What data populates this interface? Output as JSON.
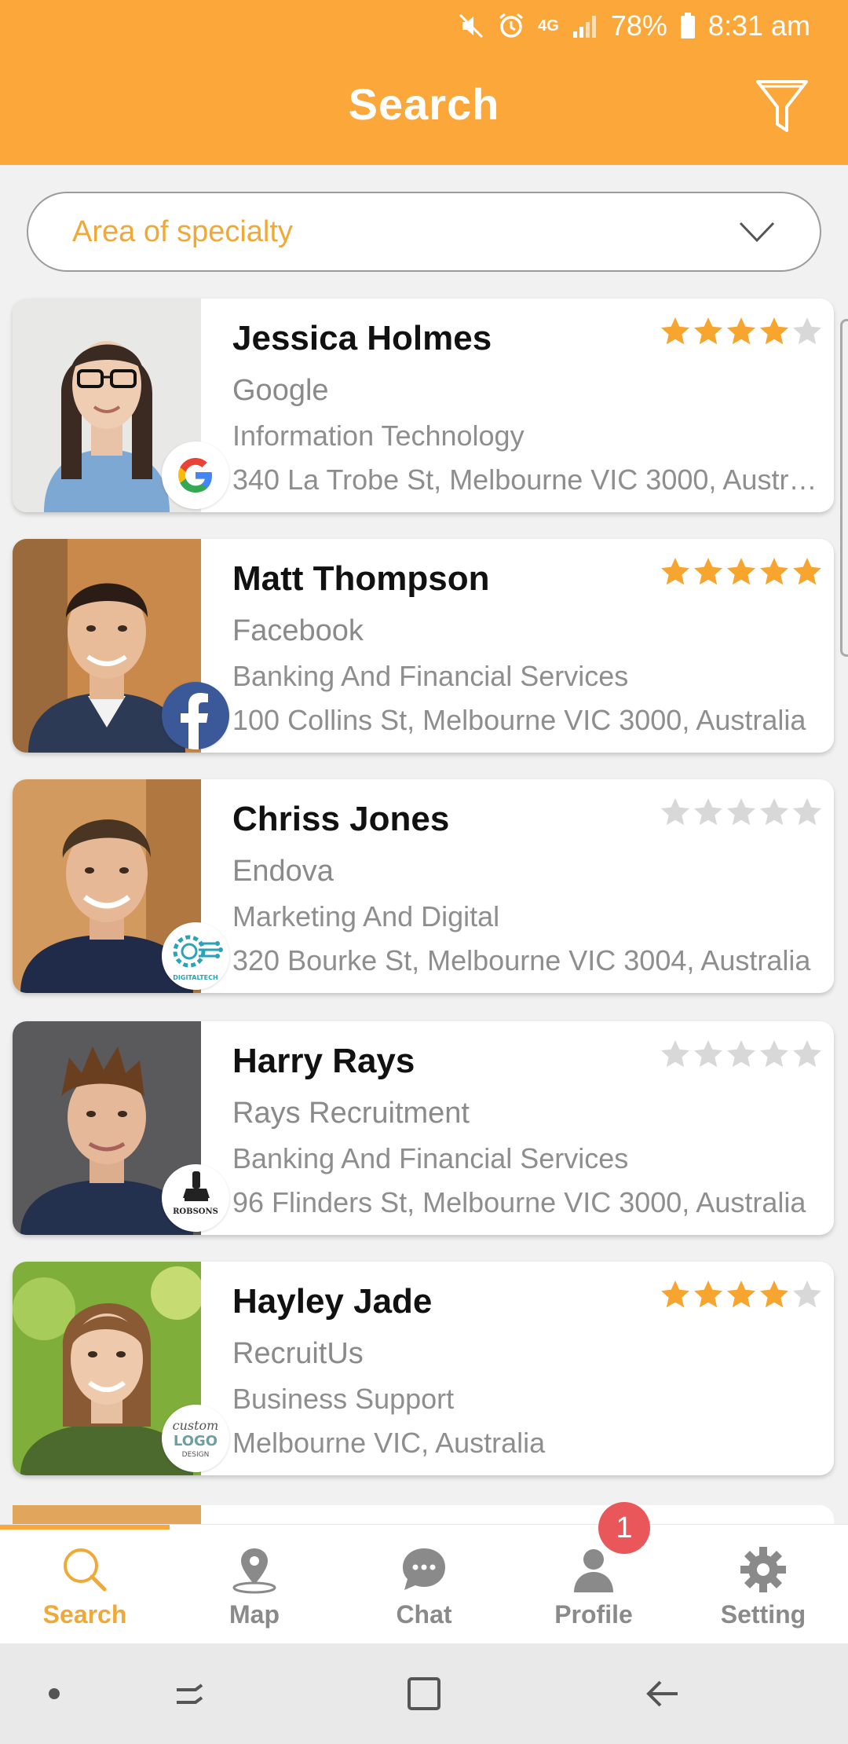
{
  "status_bar": {
    "network": "4G",
    "battery": "78%",
    "time": "8:31 am",
    "icons": [
      "mute-icon",
      "alarm-icon",
      "signal-icon",
      "battery-icon"
    ]
  },
  "header": {
    "title": "Search",
    "filter_icon": "filter-icon",
    "color": "#fba73a"
  },
  "dropdown": {
    "placeholder": "Area of specialty",
    "icon": "chevron-down-icon"
  },
  "results": [
    {
      "name": "Jessica Holmes",
      "company": "Google",
      "industry": "Information Technology",
      "address": "340 La Trobe St, Melbourne VIC 3000, Australia",
      "rating": 4,
      "logo": "google-logo"
    },
    {
      "name": "Matt Thompson",
      "company": "Facebook",
      "industry": "Banking And Financial Services",
      "address": "100 Collins St, Melbourne VIC 3000, Australia",
      "rating": 5,
      "logo": "facebook-logo"
    },
    {
      "name": "Chriss Jones",
      "company": "Endova",
      "industry": "Marketing And Digital",
      "address": "320 Bourke St, Melbourne VIC 3004, Australia",
      "rating": 0,
      "logo": "digitaltech-logo"
    },
    {
      "name": "Harry Rays",
      "company": "Rays Recruitment",
      "industry": "Banking And Financial Services",
      "address": "96 Flinders St, Melbourne VIC 3000, Australia",
      "rating": 0,
      "logo": "robsons-logo"
    },
    {
      "name": "Hayley Jade",
      "company": "RecruitUs",
      "industry": "Business Support",
      "address": "Melbourne VIC, Australia",
      "rating": 4,
      "logo": "custom-logo-design"
    }
  ],
  "logo_text": {
    "digitaltech": "DIGITALTECH",
    "robsons": "ROBSONS",
    "custom_logo": [
      "custom",
      "LOGO",
      "DESIGN"
    ]
  },
  "bottom_nav": [
    {
      "label": "Search",
      "icon": "search-icon",
      "active": true
    },
    {
      "label": "Map",
      "icon": "map-pin-icon",
      "active": false
    },
    {
      "label": "Chat",
      "icon": "chat-icon",
      "active": false
    },
    {
      "label": "Profile",
      "icon": "profile-icon",
      "active": false,
      "badge": "1"
    },
    {
      "label": "Setting",
      "icon": "gear-icon",
      "active": false
    }
  ],
  "colors": {
    "accent": "#fba73a",
    "star_on": "#f7a52f",
    "star_off": "#d8d8d8",
    "badge": "#e9575a"
  }
}
